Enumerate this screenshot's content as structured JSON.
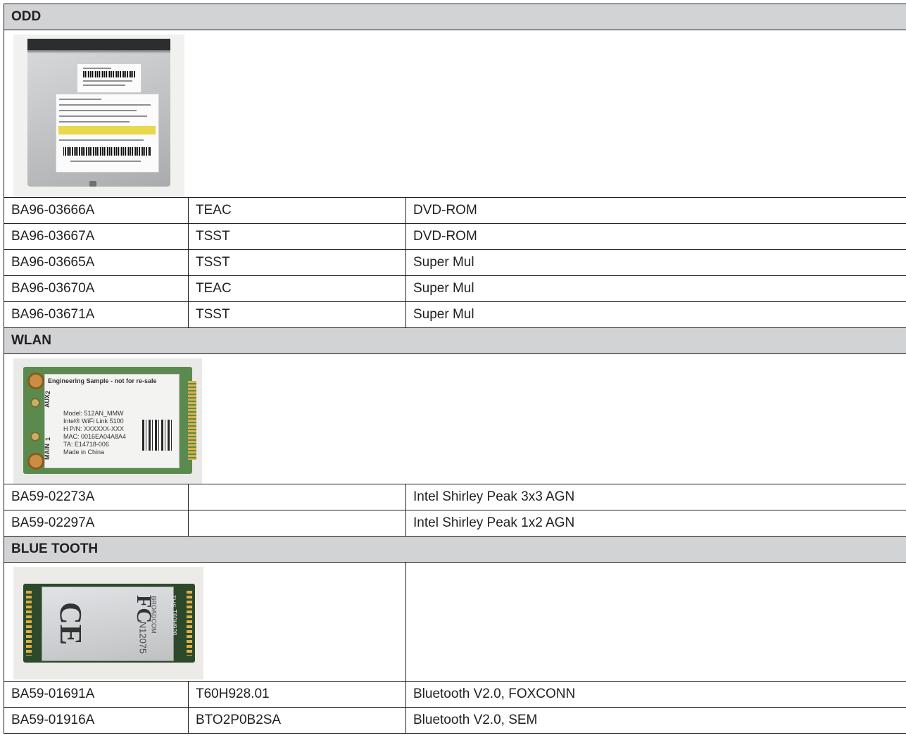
{
  "sections": [
    {
      "title": "ODD",
      "image": "optical-disc-drive-photo",
      "rows": [
        {
          "part": "BA96-03666A",
          "vendor": "TEAC",
          "desc": "DVD-ROM"
        },
        {
          "part": "BA96-03667A",
          "vendor": "TSST",
          "desc": "DVD-ROM"
        },
        {
          "part": "BA96-03665A",
          "vendor": "TSST",
          "desc": "Super Mul"
        },
        {
          "part": "BA96-03670A",
          "vendor": "TEAC",
          "desc": "Super Mul"
        },
        {
          "part": "BA96-03671A",
          "vendor": "TSST",
          "desc": "Super Mul"
        }
      ]
    },
    {
      "title": "WLAN",
      "image": "wlan-card-photo",
      "image_text": {
        "line1": "Engineering Sample - not for re-sale",
        "model": "Model: 512AN_MMW",
        "product": "Intel® WiFi Link 5100",
        "hpn": "H P/N: XXXXXX-XXX",
        "mac": "MAC: 0016EA04A8A4",
        "ta": "TA: E14718-006",
        "origin": "Made in China",
        "aux": "AUX",
        "main": "MAIN",
        "n1": "1",
        "n2": "2"
      },
      "rows": [
        {
          "part": "BA59-02273A",
          "vendor": "",
          "desc": "Intel Shirley Peak 3x3 AGN"
        },
        {
          "part": "BA59-02297A",
          "vendor": "",
          "desc": "Intel Shirley Peak 1x2 AGN"
        }
      ]
    },
    {
      "title": "BLUE TOOTH",
      "image": "bluetooth-module-photo",
      "image_text": {
        "fc": "FC",
        "ce": "CE",
        "n": "N12075",
        "brand": "BROADCOM",
        "ths": "THS",
        "model": "T60H928"
      },
      "rows": [
        {
          "part": "BA59-01691A",
          "vendor": "T60H928.01",
          "desc": "Bluetooth V2.0, FOXCONN"
        },
        {
          "part": "BA59-01916A",
          "vendor": "BTO2P0B2SA",
          "desc": "Bluetooth V2.0, SEM"
        }
      ]
    }
  ]
}
